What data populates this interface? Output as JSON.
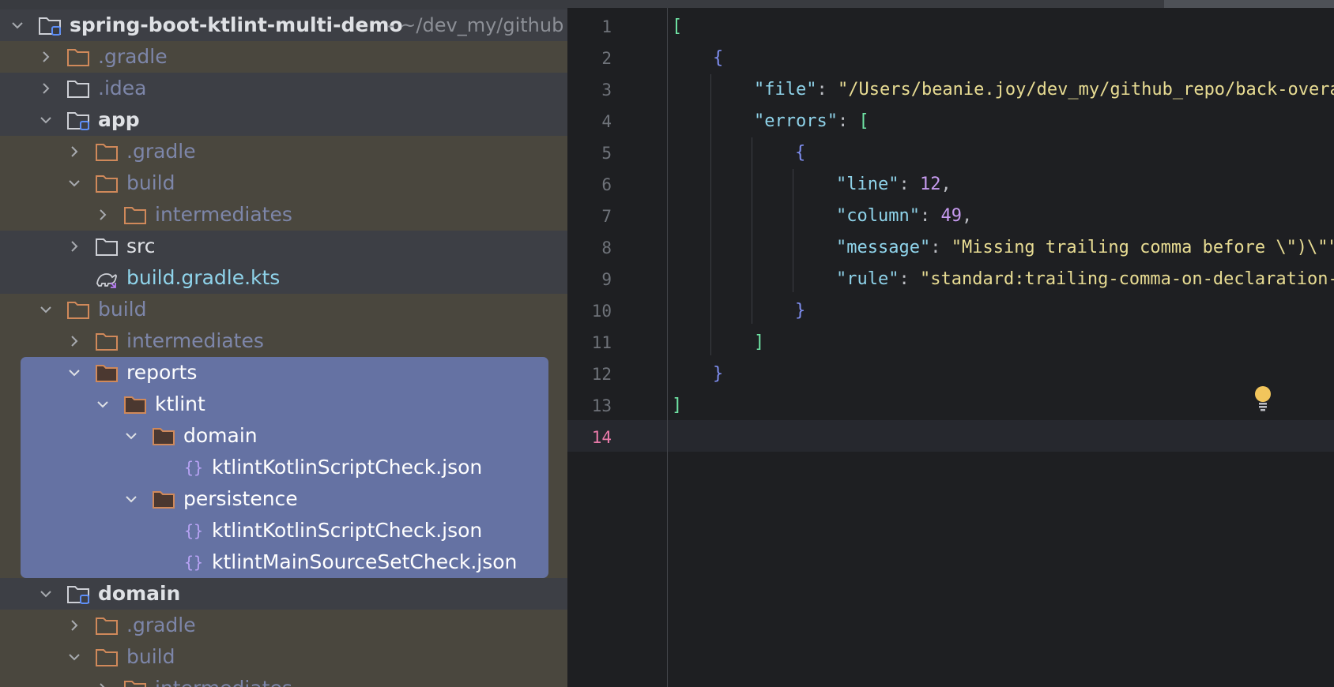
{
  "project_tree": {
    "root": {
      "name": "spring-boot-ktlint-multi-demo",
      "path_hint": "- ~/dev_my/github"
    },
    "items": [
      {
        "label": "spring-boot-ktlint-multi-demo"
      },
      {
        "label": ".gradle"
      },
      {
        "label": ".idea"
      },
      {
        "label": "app"
      },
      {
        "label": ".gradle"
      },
      {
        "label": "build"
      },
      {
        "label": "intermediates"
      },
      {
        "label": "src"
      },
      {
        "label": "build.gradle.kts"
      },
      {
        "label": "build"
      },
      {
        "label": "intermediates"
      },
      {
        "label": "reports"
      },
      {
        "label": "ktlint"
      },
      {
        "label": "domain"
      },
      {
        "label": "ktlintKotlinScriptCheck.json"
      },
      {
        "label": "persistence"
      },
      {
        "label": "ktlintKotlinScriptCheck.json"
      },
      {
        "label": "ktlintMainSourceSetCheck.json"
      },
      {
        "label": "domain"
      },
      {
        "label": ".gradle"
      },
      {
        "label": "build"
      },
      {
        "label": "intermediates"
      }
    ]
  },
  "editor": {
    "line_numbers": [
      "1",
      "2",
      "3",
      "4",
      "5",
      "6",
      "7",
      "8",
      "9",
      "10",
      "11",
      "12",
      "13",
      "14"
    ],
    "current_line": "14",
    "tokens": {
      "l1_open": "[",
      "l2_open": "{",
      "l3_key": "\"file\"",
      "l3_colon": ": ",
      "l3_val": "\"/Users/beanie.joy/dev_my/github_repo/back-overal",
      "l4_key": "\"errors\"",
      "l4_colon": ": ",
      "l4_open": "[",
      "l5_open": "{",
      "l6_key": "\"line\"",
      "l6_colon": ": ",
      "l6_val": "12",
      "l6_comma": ",",
      "l7_key": "\"column\"",
      "l7_colon": ": ",
      "l7_val": "49",
      "l7_comma": ",",
      "l8_key": "\"message\"",
      "l8_colon": ": ",
      "l8_val": "\"Missing trailing comma before \\\")\\\"\"",
      "l8_comma": ",",
      "l9_key": "\"rule\"",
      "l9_colon": ": ",
      "l9_val": "\"standard:trailing-comma-on-declaration-s",
      "l10_close": "}",
      "l11_close": "]",
      "l12_close": "}",
      "l13_close": "]"
    }
  },
  "icons": {
    "chevron": "chevron-icon",
    "folder": "folder-icon",
    "module": "module-folder-icon",
    "json": "json-file-icon",
    "gradle": "gradle-script-icon",
    "bulb": "intention-bulb-icon"
  },
  "colors": {
    "excluded_folder": "#4a473e",
    "selection": "#6572a3",
    "json_key": "#8fd3ea",
    "json_string": "#e8dc93",
    "json_number": "#c79bf0",
    "current_line_number": "#e87aa9"
  }
}
